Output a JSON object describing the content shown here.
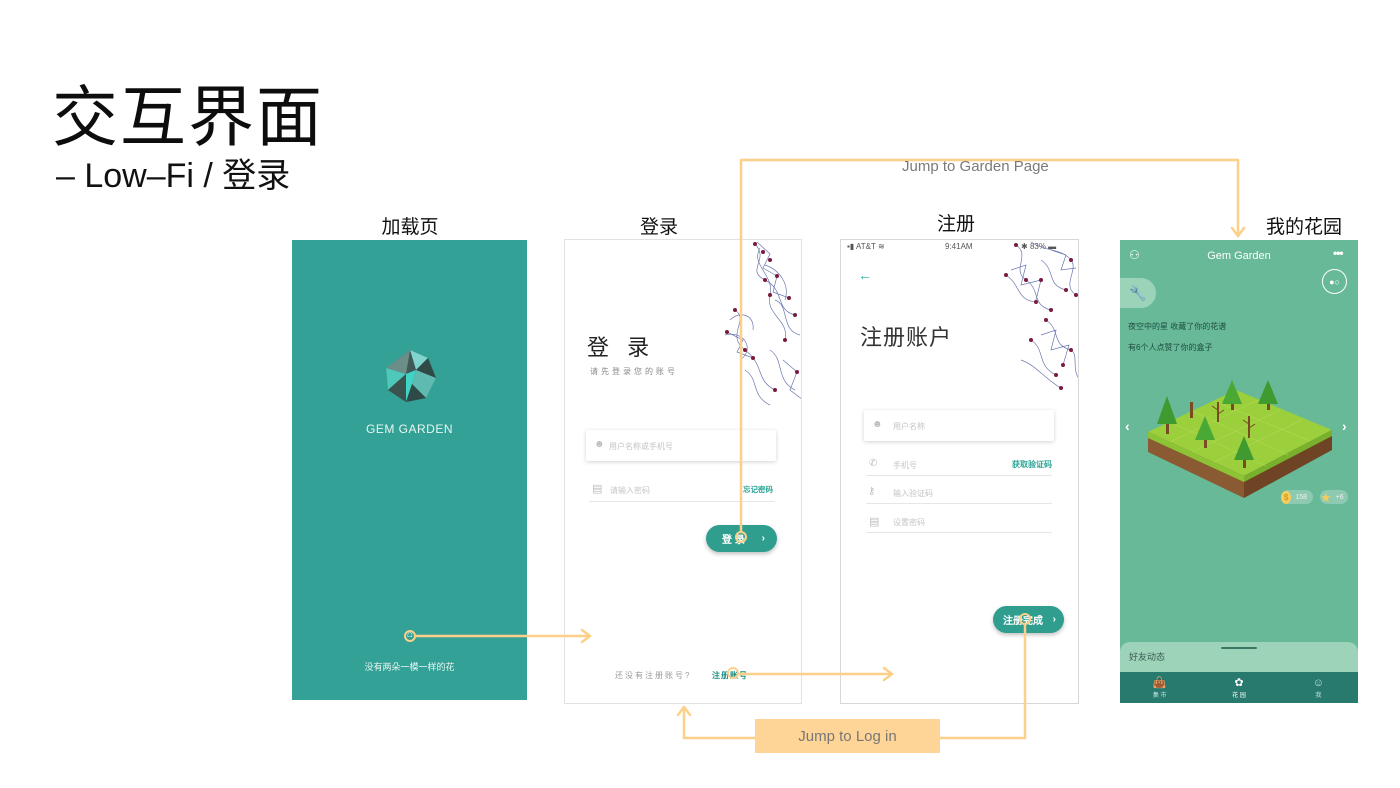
{
  "slide": {
    "title": "交互界面",
    "subtitle": "– Low–Fi / 登录"
  },
  "screen_labels": {
    "loading": "加载页",
    "login": "登录",
    "register": "注册",
    "garden": "我的花园"
  },
  "loading_screen": {
    "brand": "GEM  GARDEN",
    "tagline": "没有两朵一模一样的花",
    "icons": [
      "gem-logo-icon",
      "loading-spinner-icon"
    ],
    "background_color": "#33a196"
  },
  "login_screen": {
    "title": "登 录",
    "subtitle": "请先登录您的账号",
    "username_placeholder": "用户名称或手机号",
    "password_placeholder": "请输入密码",
    "forgot_password": "忘记密码",
    "login_button": "登 录",
    "signup_prompt": "还没有注册账号?",
    "signup_link": "注册账号"
  },
  "register_screen": {
    "status_bar": {
      "carrier": "AT&T",
      "time": "9:41AM",
      "battery": "83%"
    },
    "title": "注册账户",
    "username_placeholder": "用户名称",
    "phone_placeholder": "手机号",
    "get_code": "获取验证码",
    "code_placeholder": "输入验证码",
    "password_placeholder": "设置密码",
    "submit_button": "注册完成"
  },
  "garden_screen": {
    "header_title": "Gem Garden",
    "feed": [
      "夜空中的星 收藏了你的花谱",
      "有6个人点赞了你的盒子"
    ],
    "coins": "158",
    "stars": "+6",
    "sheet_title": "好友动态",
    "tabs": [
      {
        "label": "集 市",
        "icon": "shop-bag-icon",
        "active": false
      },
      {
        "label": "花 园",
        "icon": "flower-icon",
        "active": true
      },
      {
        "label": "我",
        "icon": "face-icon",
        "active": false
      }
    ],
    "background_color": "#67b997",
    "tabbar_color": "#277a6d"
  },
  "flow": {
    "jump_garden": "Jump to Garden Page",
    "jump_login": "Jump to Log in",
    "arrow_color": "#fdd08a"
  }
}
